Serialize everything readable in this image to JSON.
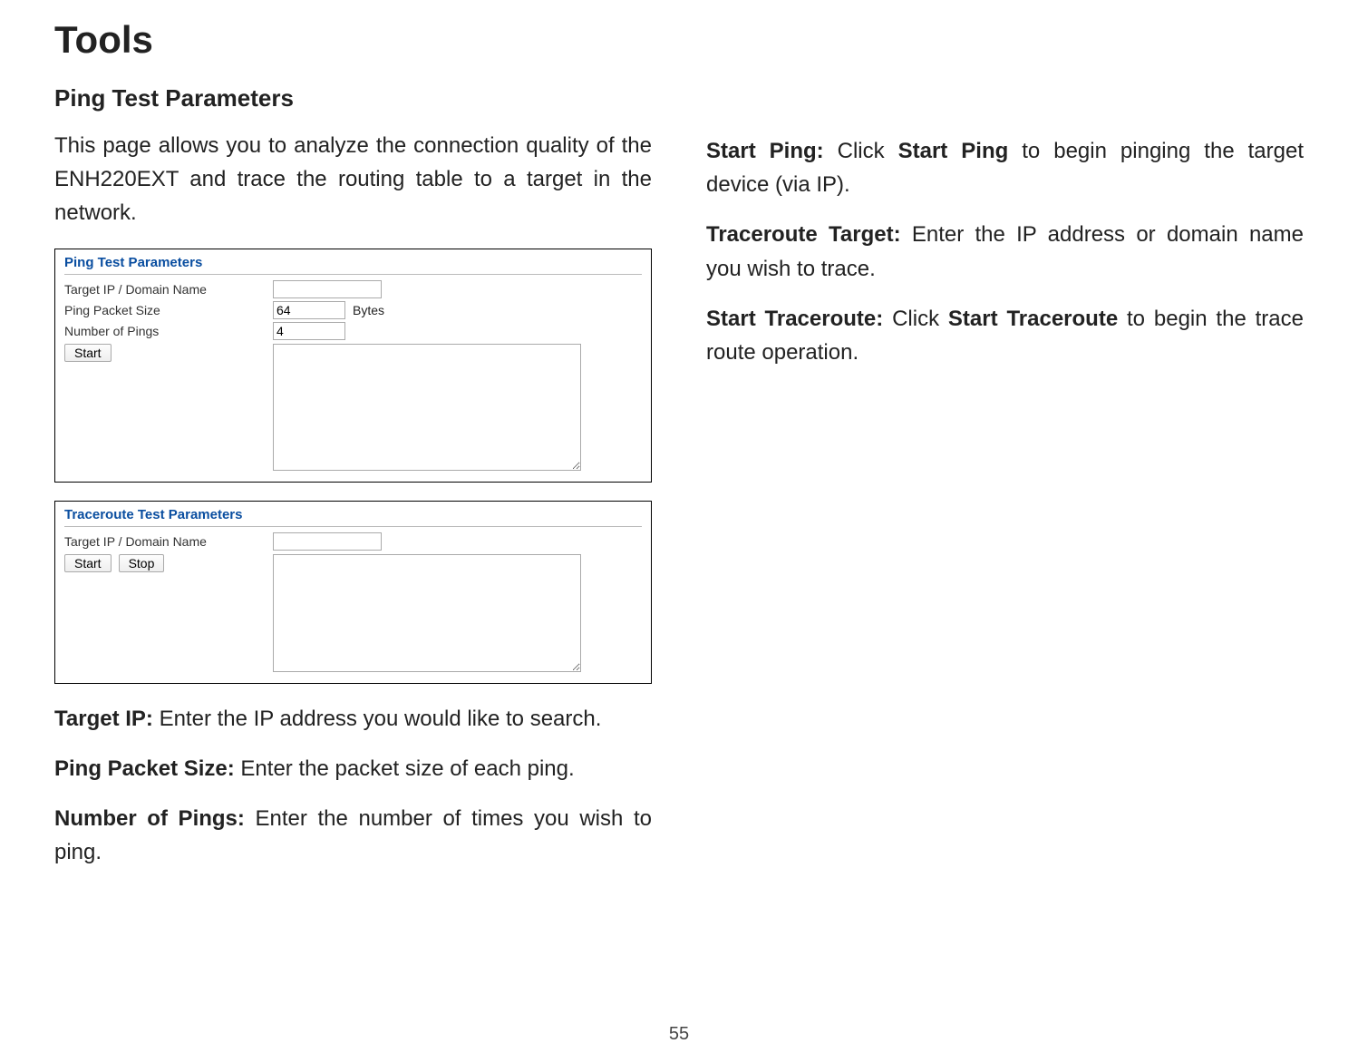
{
  "title": "Tools",
  "left": {
    "subtitle": "Ping Test Parameters",
    "intro": "This page allows you to analyze the connection quality of the ENH220EXT and trace the routing table to a target in the network.",
    "ping_panel": {
      "title": "Ping Test Parameters",
      "row1_label": "Target IP / Domain Name",
      "row1_value": "",
      "row2_label": "Ping Packet Size",
      "row2_value": "64",
      "row2_unit": "Bytes",
      "row3_label": "Number of Pings",
      "row3_value": "4",
      "start_btn": "Start"
    },
    "trace_panel": {
      "title": "Traceroute Test Parameters",
      "row1_label": "Target IP / Domain Name",
      "row1_value": "",
      "start_btn": "Start",
      "stop_btn": "Stop"
    },
    "defs": [
      {
        "label": "Target IP:",
        "text": " Enter the IP address you would like to search."
      },
      {
        "label": "Ping Packet Size:",
        "text": " Enter the packet size of each ping."
      },
      {
        "label": "Number of Pings:",
        "text": " Enter the number of times you wish to ping."
      }
    ]
  },
  "right": {
    "defs": [
      {
        "label": "Start Ping:",
        "pre": " Click ",
        "bold2": "Start Ping",
        "post": " to begin pinging the target device (via IP)."
      },
      {
        "label": "Traceroute Target:",
        "text": " Enter the IP address or domain name you wish to trace."
      },
      {
        "label": "Start Traceroute:",
        "pre": " Click ",
        "bold2": "Start Traceroute",
        "post": " to begin the trace route operation."
      }
    ]
  },
  "page_number": "55"
}
